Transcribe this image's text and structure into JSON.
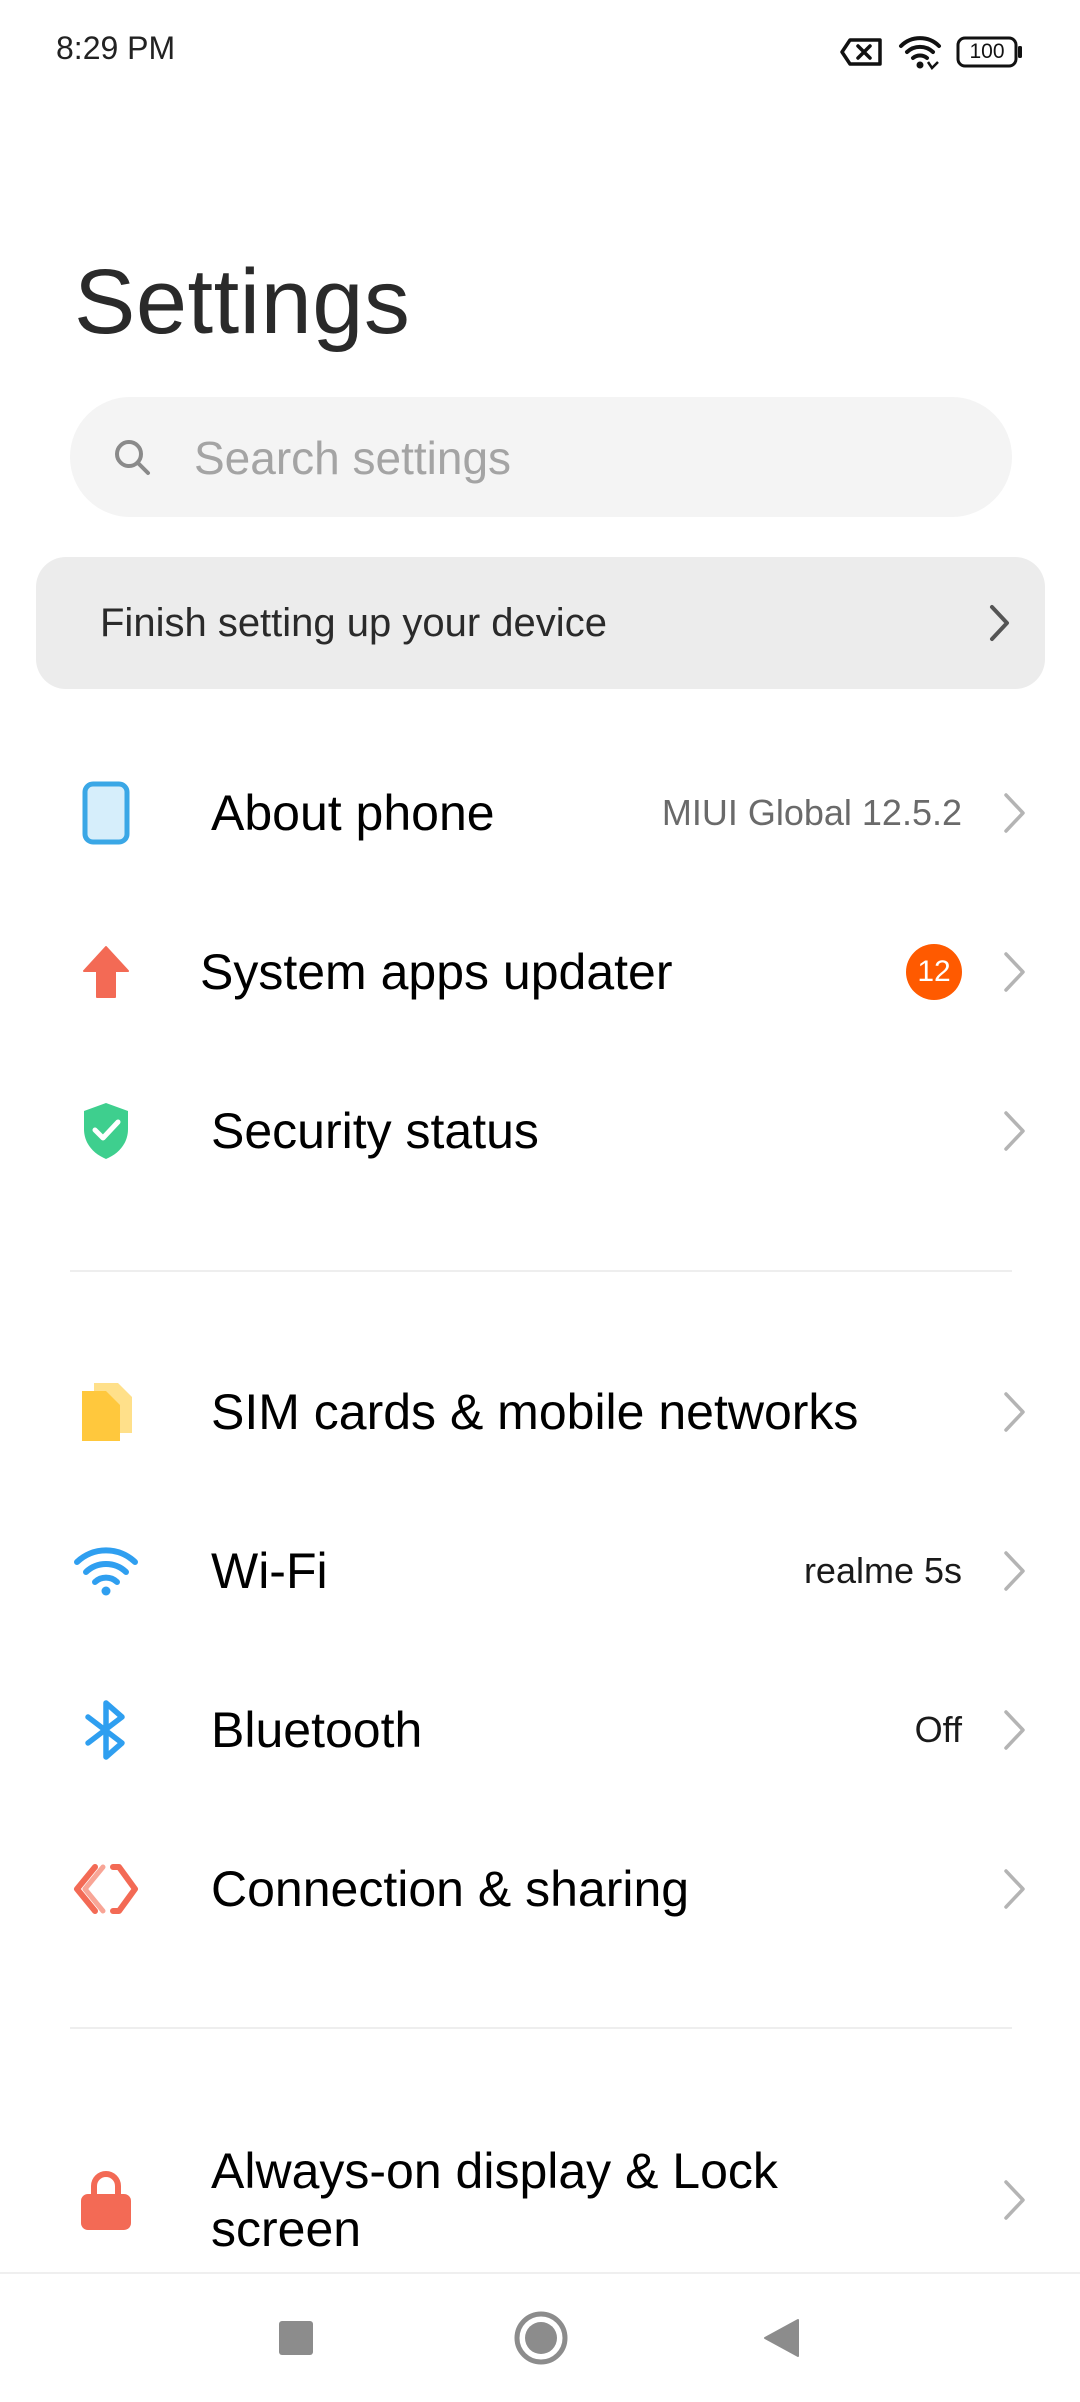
{
  "status_bar": {
    "time": "8:29 PM",
    "battery": "100",
    "icons": [
      "no-sim-icon",
      "wifi-icon",
      "battery-icon"
    ]
  },
  "page": {
    "title": "Settings"
  },
  "search": {
    "placeholder": "Search settings",
    "value": ""
  },
  "setup_card": {
    "label": "Finish setting up your device"
  },
  "groups": [
    {
      "items": [
        {
          "label": "About phone",
          "value": "MIUI Global 12.5.2",
          "icon": "phone-icon"
        },
        {
          "label": "System apps updater",
          "badge": "12",
          "icon": "arrow-up-icon"
        },
        {
          "label": "Security status",
          "icon": "shield-check-icon"
        }
      ]
    },
    {
      "items": [
        {
          "label": "SIM cards & mobile networks",
          "icon": "sim-card-icon"
        },
        {
          "label": "Wi-Fi",
          "value": "realme 5s",
          "icon": "wifi-icon"
        },
        {
          "label": "Bluetooth",
          "value": "Off",
          "icon": "bluetooth-icon"
        },
        {
          "label": "Connection & sharing",
          "icon": "connection-sharing-icon"
        }
      ]
    },
    {
      "items": [
        {
          "label": "Always-on display & Lock screen",
          "icon": "lock-icon"
        }
      ]
    }
  ],
  "colors": {
    "badge": "#ff5a00",
    "phone_icon": "#3aa7e6",
    "updater_icon": "#f36a55",
    "security_icon": "#3ecf8e",
    "sim_icon": "#ffc83d",
    "wifi_icon": "#2f9ff0",
    "bluetooth_icon": "#2f9ff0",
    "sharing_icon": "#f36a55",
    "lock_icon": "#f36a55"
  },
  "nav": {
    "buttons": [
      "recents-button",
      "home-button",
      "back-button"
    ]
  }
}
